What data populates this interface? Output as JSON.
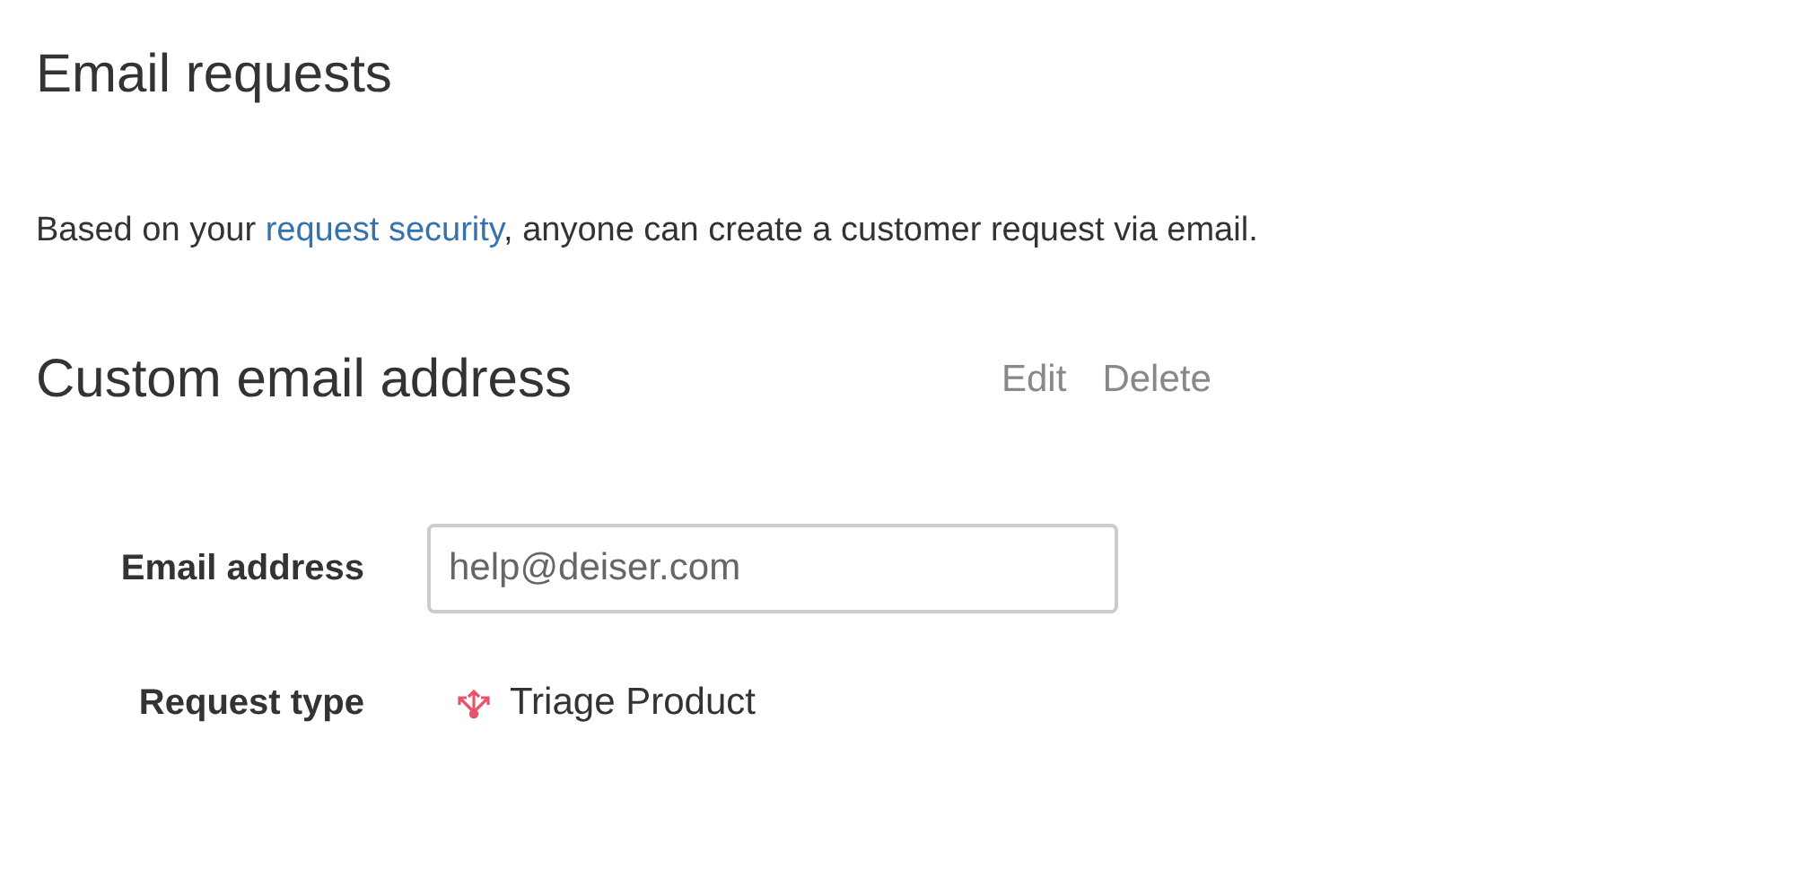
{
  "title": "Email requests",
  "intro": {
    "before": "Based on your ",
    "link": "request security",
    "after": ", anyone can create a customer request via email."
  },
  "section": {
    "title": "Custom email address",
    "actions": [
      "Edit",
      "Delete"
    ]
  },
  "fields": [
    {
      "kind": "input",
      "label": "Email address",
      "value": "help@deiser.com"
    },
    {
      "kind": "request-type",
      "label": "Request type",
      "value": "Triage Product"
    }
  ]
}
